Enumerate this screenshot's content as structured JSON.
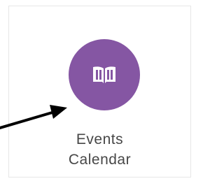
{
  "tile": {
    "label_line_1": "Events",
    "label_line_2": "Calendar",
    "icon": "open-book-icon",
    "icon_color": "#8556a3"
  },
  "annotation": {
    "type": "arrow",
    "color": "#000000"
  }
}
